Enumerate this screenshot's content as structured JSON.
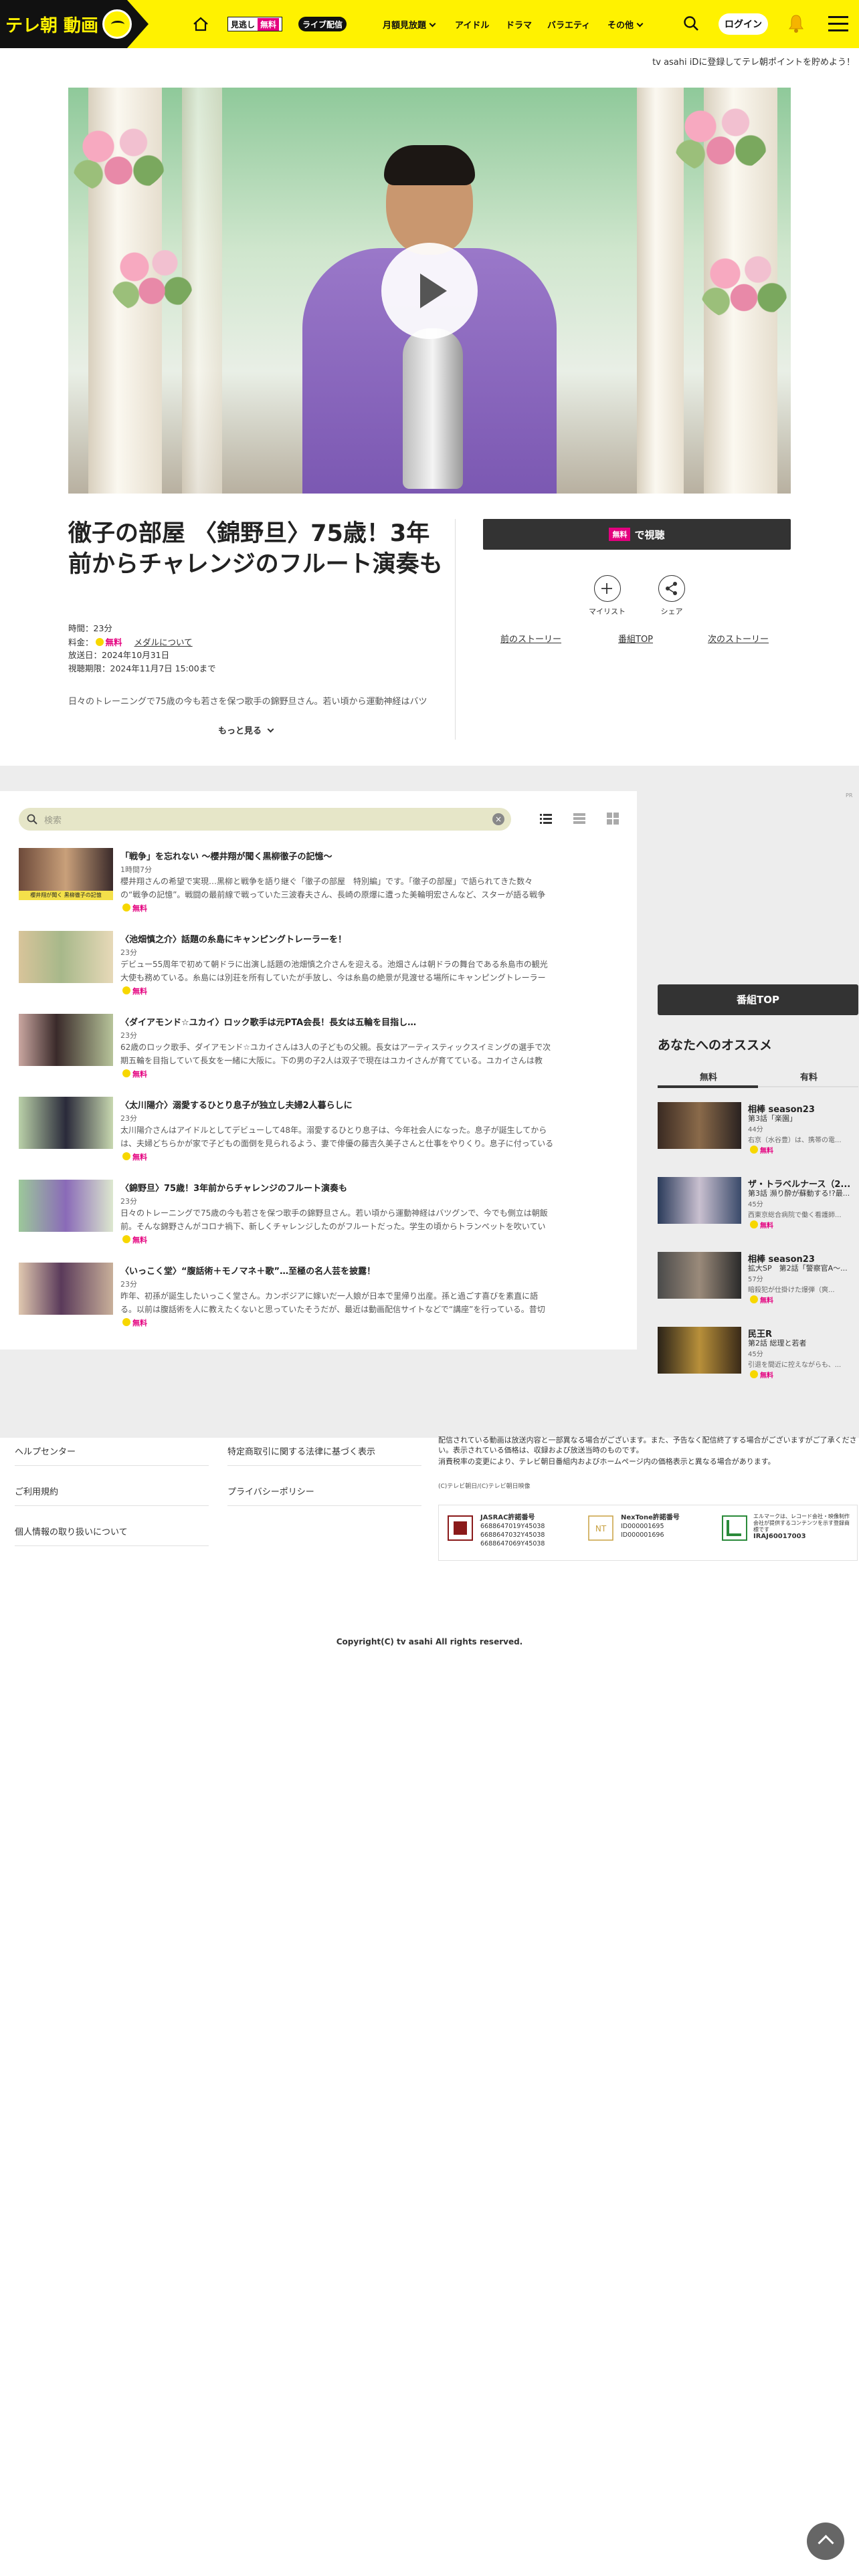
{
  "header": {
    "logo_text": "テレ朝 動画",
    "pill_label": "見逃し",
    "pill_badge": "無料",
    "live_label": "ライブ配信",
    "nav": [
      "月額見放題",
      "アイドル",
      "ドラマ",
      "バラエティ",
      "その他"
    ],
    "login_label": "ログイン",
    "promo": "tv asahi iDに登録してテレ朝ポイントを貯めよう！"
  },
  "episode": {
    "title": "徹子の部屋 〈錦野旦〉75歳！3年前からチャレンジのフルート演奏も",
    "duration": "時間：23分",
    "fee_label": "料金：",
    "fee_value": "無料",
    "medal_link": "メダルについて",
    "air_date": "放送日：2024年10月31日",
    "deadline": "視聴期限：2024年11月7日 15:00まで",
    "description": "日々のトレーニングで75歳の今も若さを保つ歌手の錦野旦さん。若い頃から運動神経はバツ",
    "more_label": "もっと見る",
    "watch_badge": "無料",
    "watch_label": "で視聴",
    "mylist_label": "マイリスト",
    "share_label": "シェア",
    "prev_label": "前のストーリー",
    "top_label": "番組TOP",
    "next_label": "次のストーリー"
  },
  "list": {
    "search_placeholder": "検索",
    "items": [
      {
        "title": "「戦争」を忘れない ～櫻井翔が聞く黒柳徹子の記憶～",
        "duration": "1時間7分",
        "desc1": "櫻井翔さんの希望で実現…黒柳と戦争を語り継ぐ「徹子の部屋　特別編」です。「徹子の部屋」で語られてきた数々",
        "desc2": "の“戦争の記憶”。戦闘の最前線で戦っていた三波春夫さん、長崎の原爆に遭った美輪明宏さんなど、スターが語る戦争",
        "free": "無料",
        "thumb_caption": "櫻井翔が聞く 黒柳徹子の記憶"
      },
      {
        "title": "〈池畑慎之介〉話題の糸島にキャンピングトレーラーを！",
        "duration": "23分",
        "desc1": "デビュー55周年で初めて朝ドラに出演し話題の池畑慎之介さんを迎える。池畑さんは朝ドラの舞台である糸島市の観光",
        "desc2": "大使も務めている。糸島には別荘を所有していたが手放し、今は糸島の絶景が見渡せる場所にキャンピングトレーラー",
        "free": "無料",
        "thumb_caption": ""
      },
      {
        "title": "〈ダイアモンド☆ユカイ〉ロック歌手は元PTA会長！長女は五輪を目指し…",
        "duration": "23分",
        "desc1": "62歳のロック歌手、ダイアモンド☆ユカイさんは3人の子どもの父親。長女はアーティスティックスイミングの選手で次",
        "desc2": "期五輪を目指していて長女を一緒に大阪に。下の男の子2人は双子で現在はユカイさんが育てている。ユカイさんは教",
        "free": "無料",
        "thumb_caption": ""
      },
      {
        "title": "〈太川陽介〉溺愛するひとり息子が独立し夫婦2人暮らしに",
        "duration": "23分",
        "desc1": "太川陽介さんはアイドルとしてデビューして48年。溺愛するひとり息子は、今年社会人になった。息子が誕生してから",
        "desc2": "は、夫婦どちらかが家で子どもの面倒を見られるよう、妻で俳優の藤吉久美子さんと仕事をやりくり。息子に付っている",
        "free": "無料",
        "thumb_caption": ""
      },
      {
        "title": "〈錦野旦〉75歳！3年前からチャレンジのフルート演奏も",
        "duration": "23分",
        "desc1": "日々のトレーニングで75歳の今も若さを保つ歌手の錦野旦さん。若い頃から運動神経はバツグンで、今でも側立は朝飯",
        "desc2": "前。そんな錦野さんがコロナ禍下、新しくチャレンジしたのがフルートだった。学生の頃からトランペットを吹いてい",
        "free": "無料",
        "thumb_caption": ""
      },
      {
        "title": "〈いっこく堂〉“腹話術＋モノマネ＋歌”…至極の名人芸を披露！",
        "duration": "23分",
        "desc1": "昨年、初孫が誕生したいっこく堂さん。カンボジアに嫁いだ一人娘が日本で里帰り出産。孫と過ごす喜びを素直に語",
        "desc2": "る。以前は腹話術を人に教えたくないと思っていたそうだが、最近は動画配信サイトなどで“講座”を行っている。昔切",
        "free": "無料",
        "thumb_caption": ""
      }
    ]
  },
  "sidebar": {
    "ad_label": "PR",
    "top_button": "番組TOP",
    "heading": "あなたへのオススメ",
    "tab_free": "無料",
    "tab_paid": "有料",
    "items": [
      {
        "title": "相棒 season23",
        "sub": "第3話「楽園」",
        "duration": "44分",
        "desc": "右京（水谷豊）は、携帯の電...",
        "free": "無料"
      },
      {
        "title": "ザ・トラベルナース（2...",
        "sub": "第3話 瀕り酔が蘇動する!?最...",
        "duration": "45分",
        "desc": "西東京総合病院で働く看護師...",
        "free": "無料"
      },
      {
        "title": "相棒 season23",
        "sub": "拡大SP　第2話「警察官A～...",
        "duration": "57分",
        "desc": "暗殺犯が仕掛けた爆弾（爽...",
        "free": "無料"
      },
      {
        "title": "民王R",
        "sub": "第2話 総理と若者",
        "duration": "45分",
        "desc": "引退を間近に控えながらも、...",
        "free": "無料"
      }
    ]
  },
  "footer": {
    "links_left": [
      "ヘルプセンター",
      "ご利用規約",
      "個人情報の取り扱いについて"
    ],
    "links_right": [
      "特定商取引に関する法律に基づく表示",
      "プライバシーポリシー"
    ],
    "note1": "配信されている動画は放送内容と一部異なる場合がございます。また、予告なく配信終了する場合がございますがご了承ください。表示されている価格は、収録および放送当時のものです。",
    "note2": "消費税率の変更により、テレビ朝日番組内およびホームページ内の価格表示と異なる場合があります。",
    "note3": "(C)テレビ朝日/(C)テレビ朝日映像",
    "jasrac_title": "JASRAC許諾番号",
    "jasrac_nums": [
      "6688647019Y45038",
      "6688647032Y45038",
      "6688647069Y45038"
    ],
    "nextone_title": "NexTone許諾番号",
    "nextone_nums": [
      "ID000001695",
      "ID000001696"
    ],
    "lmark_text": "エルマークは、レコード会社・映像制作会社が提供するコンテンツを示す登録商標です",
    "lmark_num": "IRAJ60017003",
    "copyright": "Copyright(C) tv asahi All rights reserved."
  }
}
